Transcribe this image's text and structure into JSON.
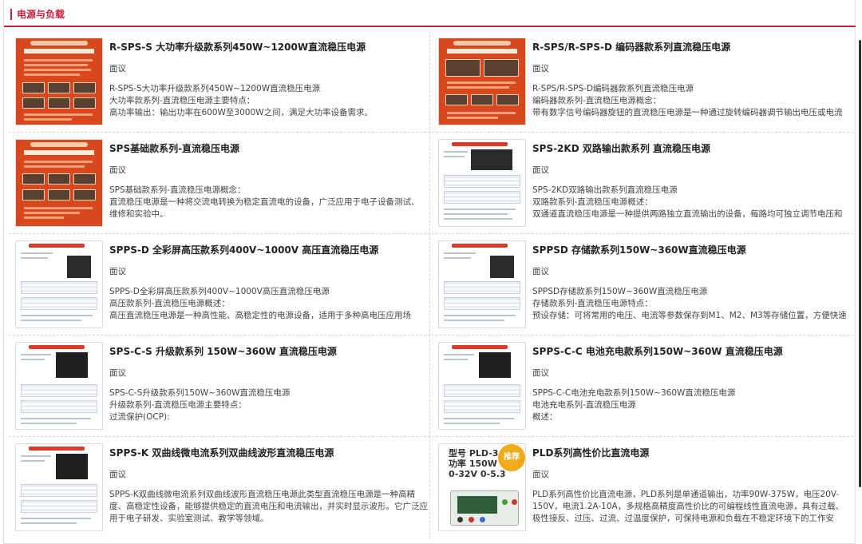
{
  "section": {
    "title": "电源与负载"
  },
  "badge_label": "推荐",
  "pld_thumb": {
    "line1": "型号 PLD-3",
    "line2": "功率 150W",
    "line3": "0-32V  0-5.3"
  },
  "products": [
    {
      "title": "R-SPS-S 大功率升级款系列450W~1200W直流稳压电源",
      "price": "面议",
      "desc": [
        "R-SPS-S大功率升级款系列450W~1200W直流稳压电源",
        "大功率款系列-直流稳压电源主要特点：",
        "高功率输出：输出功率在600W至3000W之间，满足大功率设备需求。"
      ]
    },
    {
      "title": "R-SPS/R-SPS-D 编码器款系列直流稳压电源",
      "price": "面议",
      "desc": [
        "R-SPS/R-SPS-D编码器款系列直流稳压电源",
        "编码器款系列-直流稳压电源概念：",
        "带有数字信号编码器旋钮的直流稳压电源是一种通过旋转编码器调节输出电压或电流"
      ]
    },
    {
      "title": "SPS基础款系列-直流稳压电源",
      "price": "面议",
      "desc": [
        "SPS基础款系列-直流稳压电源概念：",
        "直流稳压电源是一种将交流电转换为稳定直流电的设备，广泛应用于电子设备测试、",
        "维修和实验中。"
      ]
    },
    {
      "title": "SPS-2KD 双路输出款系列 直流稳压电源",
      "price": "面议",
      "desc": [
        "SPS-2KD双路输出款系列直流稳压电源",
        "双路款系列-直流稳压电源概述：",
        "双通道直流稳压电源是一种提供两路独立直流输出的设备，每路均可独立调节电压和"
      ]
    },
    {
      "title": "SPPS-D 全彩屏高压款系列400V~1000V 高压直流稳压电源",
      "price": "面议",
      "desc": [
        "SPPS-D全彩屏高压款系列400V~1000V高压直流稳压电源",
        "高压款系列-直流稳压电源概述：",
        "高压直流稳压电源是一种高性能、高稳定性的电源设备，适用于多种高电压应用场"
      ]
    },
    {
      "title": "SPPSD 存储款系列150W~360W直流稳压电源",
      "price": "面议",
      "desc": [
        "SPPSD存储款系列150W~360W直流稳压电源",
        "存储款系列-直流稳压电源特点：",
        "预设存储：可将常用的电压、电流等参数保存到M1、M2、M3等存储位置，方便快速"
      ]
    },
    {
      "title": "SPS-C-S 升级款系列 150W~360W 直流稳压电源",
      "price": "面议",
      "desc": [
        "SPS-C-S升级款系列150W~360W直流稳压电源",
        "升级款系列-直流稳压电源主要特点：",
        "过流保护(OCP):"
      ]
    },
    {
      "title": "SPPS-C-C 电池充电款系列150W~360W 直流稳压电源",
      "price": "面议",
      "desc": [
        "SPPS-C-C电池充电款系列150W~360W直流稳压电源",
        "电池充电系列-直流稳压电源",
        "概述："
      ]
    },
    {
      "title": "SPPS-K 双曲线微电流系列双曲线波形直流稳压电源",
      "price": "面议",
      "desc": [
        "SPPS-K双曲线微电流系列双曲线波形直流稳压电源此类型直流稳压电源是一种高精度、高稳定性设备，能够提供稳定的直流电压和电流输出，并实时显示波形。它广泛应用于电子研发、实验室测试、教学等领域。"
      ]
    },
    {
      "title": "PLD系列高性价比直流电源",
      "price": "面议",
      "desc": [
        "PLD系列高性价比直流电源，PLD系列是单通道输出，功率90W-375W，电压20V-150V，电流1.2A-10A，多规格高精度高性价比的可编程线性直流电源，具有过载、极性接反、过压、过流、过温度保护，可保持电源和负载在不稳定环境下的工作安"
      ]
    }
  ]
}
